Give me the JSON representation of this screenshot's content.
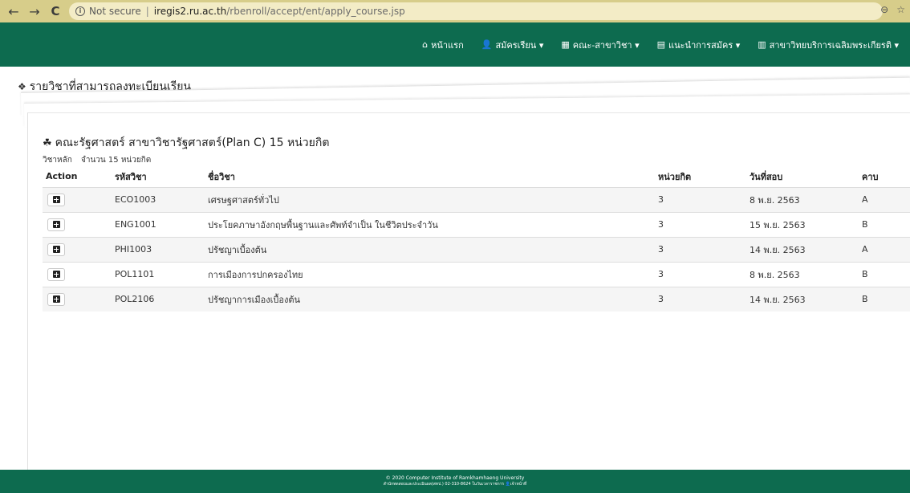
{
  "browser": {
    "security_text": "Not secure",
    "domain": "iregis2.ru.ac.th",
    "path": "/rbenroll/accept/ent/apply_course.jsp"
  },
  "navbar": {
    "items": [
      {
        "icon": "home-icon",
        "label": "หน้าแรก"
      },
      {
        "icon": "user-plus-icon",
        "label": "สมัครเรียน ▾"
      },
      {
        "icon": "building-icon",
        "label": "คณะ-สาขาวิชา ▾"
      },
      {
        "icon": "list-icon",
        "label": "แนะนำการสมัคร ▾"
      },
      {
        "icon": "card-icon",
        "label": "สาขาวิทยบริการเฉลิมพระเกียรติ ▾"
      }
    ]
  },
  "page": {
    "title": "รายวิชาที่สามารถลงทะเบียนเรียน"
  },
  "card": {
    "title": "คณะรัฐศาสตร์ สาขาวิชารัฐศาสตร์(Plan C) 15 หน่วยกิต",
    "sub_label": "วิชาหลัก",
    "sub_count": "จำนวน 15 หน่วยกิต"
  },
  "table": {
    "headers": [
      "Action",
      "รหัสวิชา",
      "ชื่อวิชา",
      "หน่วยกิต",
      "วันที่สอบ",
      "คาบ"
    ],
    "rows": [
      {
        "code": "ECO1003",
        "name": "เศรษฐศาสตร์ทั่วไป",
        "credit": "3",
        "exam": "8 พ.ย. 2563",
        "period": "A"
      },
      {
        "code": "ENG1001",
        "name": "ประโยคภาษาอังกฤษพื้นฐานและศัพท์จำเป็น ในชีวิตประจำวัน",
        "credit": "3",
        "exam": "15 พ.ย. 2563",
        "period": "B"
      },
      {
        "code": "PHI1003",
        "name": "ปรัชญาเบื้องต้น",
        "credit": "3",
        "exam": "14 พ.ย. 2563",
        "period": "A"
      },
      {
        "code": "POL1101",
        "name": "การเมืองการปกครองไทย",
        "credit": "3",
        "exam": "8 พ.ย. 2563",
        "period": "B"
      },
      {
        "code": "POL2106",
        "name": "ปรัชญาการเมืองเบื้องต้น",
        "credit": "3",
        "exam": "14 พ.ย. 2563",
        "period": "B"
      }
    ]
  },
  "footer": {
    "line1": "© 2020 Computer Institute of Ramkhamhaeng University",
    "line2": "สำนักทดสอบและประเมินผล(สทป.) 02-310-8624 ในวันเวลาราชการ 👤เจ้าหน้าที่"
  }
}
